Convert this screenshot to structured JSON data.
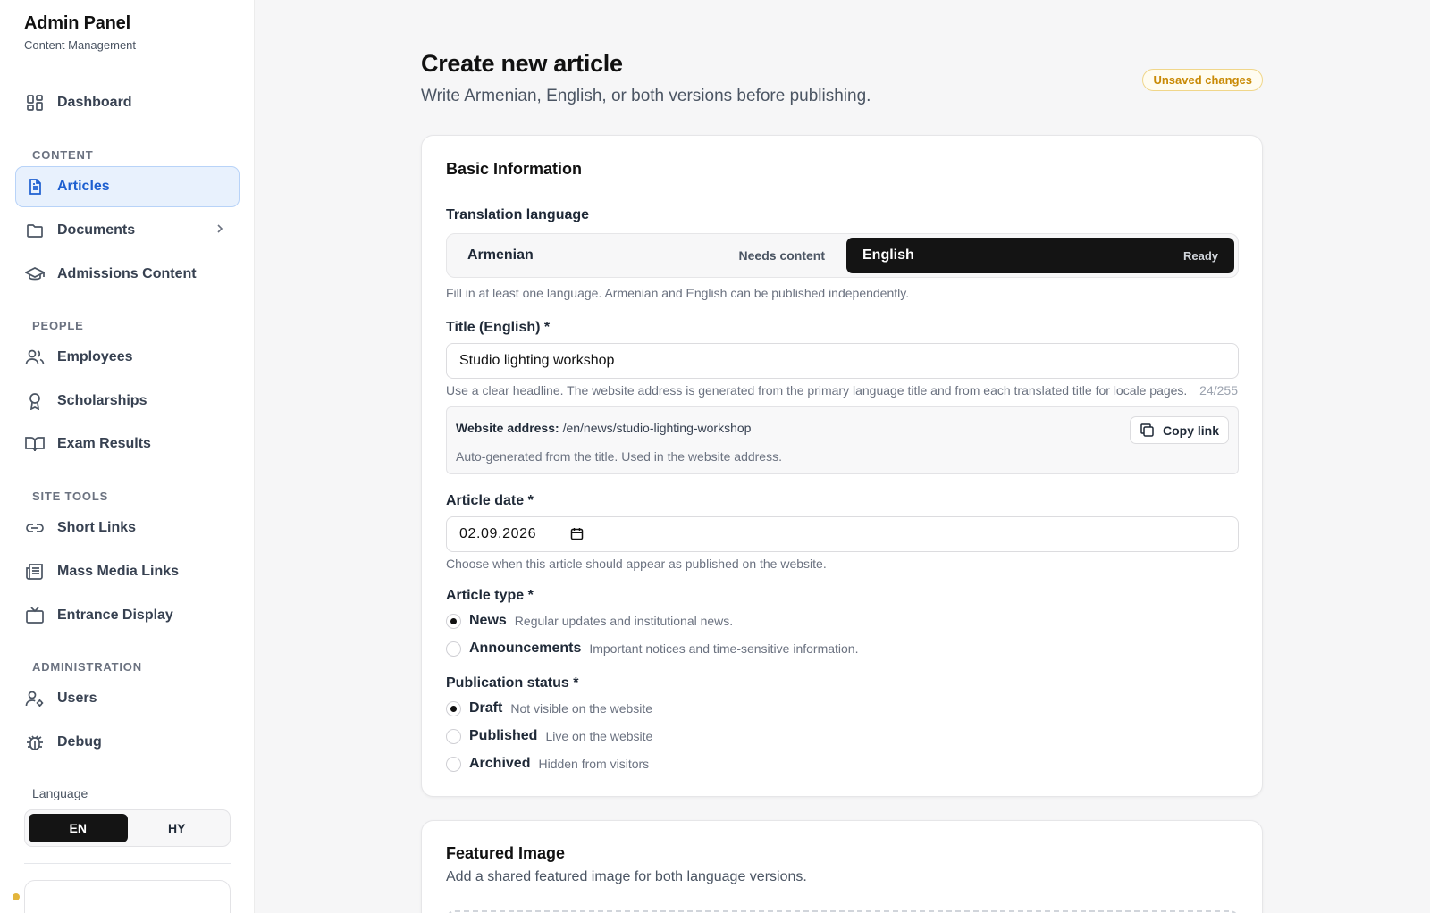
{
  "sidebar": {
    "brand_title": "Admin Panel",
    "brand_subtitle": "Content Management",
    "dashboard_label": "Dashboard",
    "sections": {
      "content": "CONTENT",
      "people": "PEOPLE",
      "site_tools": "SITE TOOLS",
      "administration": "ADMINISTRATION"
    },
    "items": {
      "articles": "Articles",
      "documents": "Documents",
      "admissions": "Admissions Content",
      "employees": "Employees",
      "scholarships": "Scholarships",
      "exam_results": "Exam Results",
      "short_links": "Short Links",
      "mass_media": "Mass Media Links",
      "entrance_display": "Entrance Display",
      "users": "Users",
      "debug": "Debug"
    },
    "active_item": "Articles",
    "language_label": "Language",
    "languages": [
      "EN",
      "HY"
    ],
    "selected_language": "EN"
  },
  "header": {
    "title": "Create new article",
    "subtitle": "Write Armenian, English, or both versions before publishing.",
    "badge": "Unsaved changes"
  },
  "basic_info": {
    "title": "Basic Information",
    "translation_label": "Translation language",
    "languages": [
      {
        "name": "Armenian",
        "status": "Needs content",
        "selected": false
      },
      {
        "name": "English",
        "status": "Ready",
        "selected": true
      }
    ],
    "translation_hint": "Fill in at least one language. Armenian and English can be published independently.",
    "title_label": "Title (English) *",
    "title_value": "Studio lighting workshop",
    "title_hint": "Use a clear headline. The website address is generated from the primary language title and from each translated title for locale pages.",
    "title_counter": "24/255",
    "address_label": "Website address:",
    "address_value": "/en/news/studio-lighting-workshop",
    "address_hint": "Auto-generated from the title. Used in the website address.",
    "copy_label": "Copy link",
    "date_label": "Article date *",
    "date_value": "02.09.2026",
    "date_hint": "Choose when this article should appear as published on the website.",
    "type_label": "Article type *",
    "types": [
      {
        "label": "News",
        "desc": "Regular updates and institutional news.",
        "selected": true
      },
      {
        "label": "Announcements",
        "desc": "Important notices and time-sensitive information.",
        "selected": false
      }
    ],
    "status_label": "Publication status *",
    "statuses": [
      {
        "label": "Draft",
        "desc": "Not visible on the website",
        "selected": true
      },
      {
        "label": "Published",
        "desc": "Live on the website",
        "selected": false
      },
      {
        "label": "Archived",
        "desc": "Hidden from visitors",
        "selected": false
      }
    ]
  },
  "featured": {
    "title": "Featured Image",
    "subtitle": "Add a shared featured image for both language versions."
  },
  "colors": {
    "accent": "#1d5fd0",
    "active_bg": "#e8f1fd",
    "dark": "#141414",
    "badge": "#c98a06"
  }
}
